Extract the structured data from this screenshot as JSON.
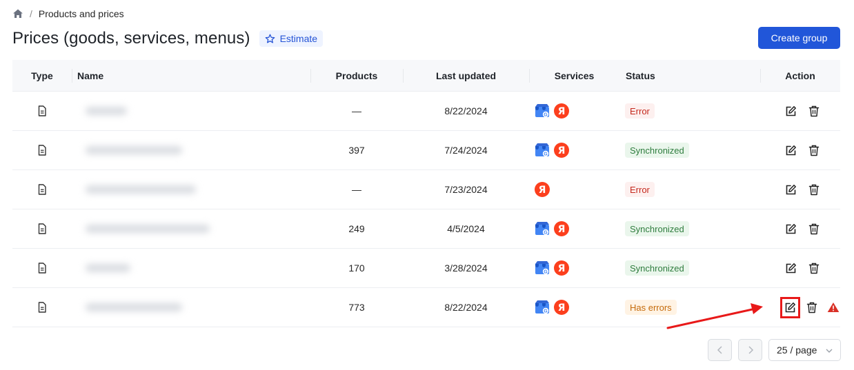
{
  "breadcrumb": {
    "home_icon": "home-icon",
    "separator": "/",
    "current": "Products and prices"
  },
  "header": {
    "title": "Prices (goods, services, menus)",
    "estimate_label": "Estimate",
    "create_group_label": "Create group"
  },
  "colors": {
    "primary": "#2156d9",
    "error": "#c4281c",
    "success": "#2f7d3e",
    "warning": "#c56a0a",
    "highlight": "#e81919"
  },
  "table": {
    "columns": [
      "Type",
      "Name",
      "Products",
      "Last updated",
      "Services",
      "Status",
      "Action"
    ],
    "rows": [
      {
        "products": "—",
        "updated": "8/22/2024",
        "services": [
          "google-business-icon",
          "yandex-icon"
        ],
        "status": "Error",
        "status_kind": "error",
        "warning": false
      },
      {
        "products": "397",
        "updated": "7/24/2024",
        "services": [
          "google-business-icon",
          "yandex-icon"
        ],
        "status": "Synchronized",
        "status_kind": "sync",
        "warning": false
      },
      {
        "products": "—",
        "updated": "7/23/2024",
        "services": [
          "yandex-icon"
        ],
        "status": "Error",
        "status_kind": "error",
        "warning": false
      },
      {
        "products": "249",
        "updated": "4/5/2024",
        "services": [
          "google-business-icon",
          "yandex-icon"
        ],
        "status": "Synchronized",
        "status_kind": "sync",
        "warning": false
      },
      {
        "products": "170",
        "updated": "3/28/2024",
        "services": [
          "google-business-icon",
          "yandex-icon"
        ],
        "status": "Synchronized",
        "status_kind": "sync",
        "warning": false
      },
      {
        "products": "773",
        "updated": "8/22/2024",
        "services": [
          "google-business-icon",
          "yandex-icon"
        ],
        "status": "Has errors",
        "status_kind": "errors",
        "warning": true
      }
    ]
  },
  "pagination": {
    "page_size_label": "25 / page"
  }
}
